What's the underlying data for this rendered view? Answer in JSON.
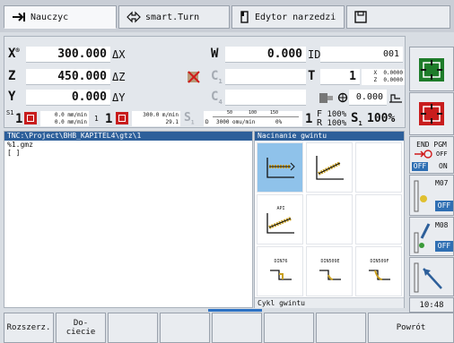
{
  "tabs": [
    {
      "label": "Nauczyc",
      "icon": "arrow-right-icon"
    },
    {
      "label": "smart.Turn",
      "icon": "program-arrows-icon"
    },
    {
      "label": "Edytor narzedzi",
      "icon": "tool-icon"
    },
    {
      "label": "",
      "icon": "floppy-icon"
    }
  ],
  "position": {
    "x": {
      "axis": "X",
      "sup": "®",
      "value": "300.000",
      "delta_label": "ΔX"
    },
    "z": {
      "axis": "Z",
      "value": "450.000",
      "delta_label": "ΔZ"
    },
    "y": {
      "axis": "Y",
      "value": "0.000",
      "delta_label": "ΔY"
    },
    "w": {
      "axis": "W",
      "value": "0.000",
      "id_label": "ID",
      "id_value": "001"
    },
    "c1": {
      "axis": "C",
      "sub": "1"
    },
    "c4": {
      "axis": "C",
      "sub": "4"
    },
    "t": {
      "axis": "T",
      "value": "1",
      "x_corr": "0.0000",
      "z_corr": "0.0000",
      "x_label": "X",
      "z_label": "Z"
    },
    "spindle_pos": "0.000"
  },
  "feed": {
    "s1_label": "S1",
    "s1_value": "1",
    "feed_actual": "0.0 mm/min",
    "feed_set": "0.0 mm/min",
    "spindle2_value": "1",
    "feed2_actual": "300.0 m/min",
    "feed2_set": "29.1",
    "s_gray": "S",
    "s_gray_sub": "1",
    "gauge_ticks": [
      "50",
      "100",
      "150"
    ],
    "gauge_value": "3000 omu/min",
    "gauge_d": "D",
    "override_small": "0%",
    "override_idx": "1",
    "f_label": "F",
    "f_pct": "100%",
    "r_label": "R",
    "r_pct": "100%",
    "s1b_label": "S",
    "s1b_sub": "1",
    "s_pct": "100%"
  },
  "program": {
    "path": "TNC:\\Project\\BHB_KAPITEL4\\gtz\\1",
    "lines": [
      "%1.gmz",
      "[ ]"
    ]
  },
  "cycles": {
    "title": "Nacinanie gwintu",
    "items": [
      {
        "label": "",
        "icon": "thread-cycle-icon",
        "selected": true
      },
      {
        "label": "",
        "icon": "thread-cycle-taper-icon",
        "selected": false
      },
      {
        "label": "",
        "icon": "empty",
        "selected": false
      },
      {
        "label": "API",
        "icon": "api-thread-icon",
        "selected": false
      },
      {
        "label": "",
        "icon": "empty",
        "selected": false
      },
      {
        "label": "",
        "icon": "empty",
        "selected": false
      },
      {
        "label": "DIN76",
        "icon": "undercut-din76-icon",
        "selected": false
      },
      {
        "label": "DIN509E",
        "icon": "undercut-din509e-icon",
        "selected": false
      },
      {
        "label": "DIN509F",
        "icon": "undercut-din509f-icon",
        "selected": false
      }
    ],
    "footer": "Cykl gwintu"
  },
  "right_softkeys": {
    "end_pgm": "END PGM",
    "off1": "OFF",
    "on1": "ON",
    "m07": "M07",
    "off2": "OFF",
    "m08": "M08",
    "off3": "OFF",
    "time": "10:48"
  },
  "bottom_softkeys": {
    "extend": "Rozszerz.",
    "undercut": "Do-\nciecie",
    "back": "Powrót"
  },
  "colors": {
    "accent_blue": "#2d5f9a",
    "selected_cell": "#8fc2ea",
    "green": "#1e7c2a",
    "red": "#c81d1d"
  }
}
